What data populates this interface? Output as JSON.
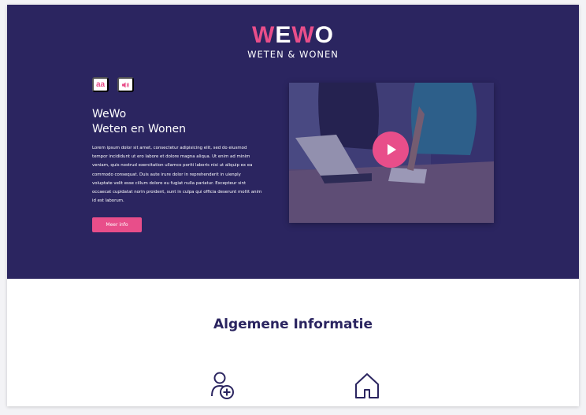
{
  "logo": {
    "mark_first": "W",
    "mark_second": "E",
    "mark_third": "W",
    "mark_fourth": "O",
    "subtitle": "WETEN & WONEN"
  },
  "tools": [
    {
      "label": "aa",
      "icon": "text-size-icon"
    },
    {
      "label": "",
      "icon": "speaker-icon"
    }
  ],
  "hero": {
    "title_line1": "WeWo",
    "title_line2": "Weten en Wonen",
    "body": "Lorem ipsum dolor sit amet, consectetur adipisicing elit, sed do eiusmod tempor incididunt ut ero labore et dolore magna aliqua. Ut enim ad minim veniam, quis nostrud exercitation ullamco poriti laboris nisi ut aliquip ex ea commodo consequat. Duis aute irure dolor in reprehenderit in uienply voluptate velit esse cillum dolore eu fugiat nulla pariatur. Excepteur sint occaecat cupidatat norin proident, sunt in culpa qui officia deserunt mollit anim id est laborum.",
    "button": "Meer info"
  },
  "video": {
    "icon": "play-icon"
  },
  "section": {
    "title": "Algemene Informatie"
  },
  "features": [
    {
      "icon": "user-add-icon"
    },
    {
      "icon": "home-icon"
    }
  ],
  "colors": {
    "brand_dark": "#2b2560",
    "accent": "#e84e8a",
    "white": "#ffffff"
  }
}
